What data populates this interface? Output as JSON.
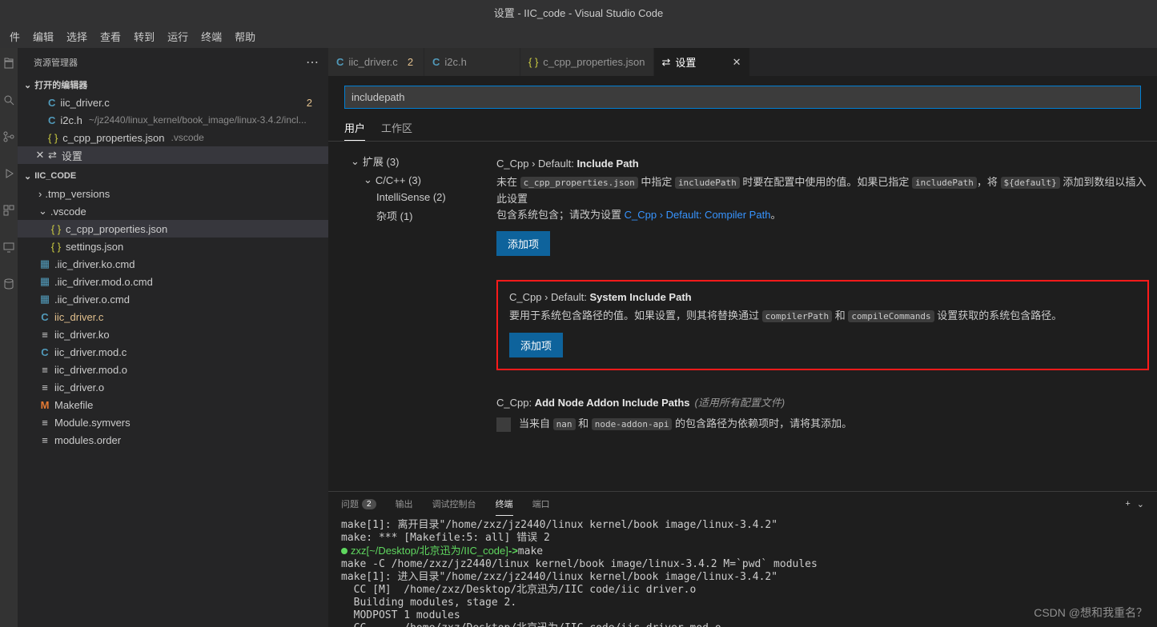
{
  "window_title": "设置 - IIC_code - Visual Studio Code",
  "menu": [
    "件",
    "编辑",
    "选择",
    "查看",
    "转到",
    "运行",
    "终端",
    "帮助"
  ],
  "sidebar": {
    "title": "资源管理器",
    "open_editors": {
      "label": "打开的编辑器",
      "items": [
        {
          "name": "iic_driver.c",
          "modified": true,
          "badge": "2",
          "icon": "c"
        },
        {
          "name": "i2c.h",
          "path": "~/jz2440/linux_kernel/book_image/linux-3.4.2/incl...",
          "icon": "c"
        },
        {
          "name": "c_cpp_properties.json",
          "path": ".vscode",
          "icon": "json"
        },
        {
          "name": "设置",
          "icon": "gear",
          "active": true
        }
      ]
    },
    "folder": {
      "label": "IIC_CODE",
      "tree": [
        {
          "label": ".tmp_versions",
          "type": "folder",
          "depth": 1,
          "expanded": false
        },
        {
          "label": ".vscode",
          "type": "folder",
          "depth": 1,
          "expanded": true
        },
        {
          "label": "c_cpp_properties.json",
          "type": "json",
          "depth": 2,
          "selected": true
        },
        {
          "label": "settings.json",
          "type": "json",
          "depth": 2
        },
        {
          "label": ".iic_driver.ko.cmd",
          "type": "bin",
          "depth": 1
        },
        {
          "label": ".iic_driver.mod.o.cmd",
          "type": "bin",
          "depth": 1
        },
        {
          "label": ".iic_driver.o.cmd",
          "type": "bin",
          "depth": 1
        },
        {
          "label": "iic_driver.c",
          "type": "c",
          "depth": 1,
          "modified": true
        },
        {
          "label": "iic_driver.ko",
          "type": "txt",
          "depth": 1
        },
        {
          "label": "iic_driver.mod.c",
          "type": "c",
          "depth": 1
        },
        {
          "label": "iic_driver.mod.o",
          "type": "txt",
          "depth": 1
        },
        {
          "label": "iic_driver.o",
          "type": "txt",
          "depth": 1
        },
        {
          "label": "Makefile",
          "type": "m",
          "depth": 1
        },
        {
          "label": "Module.symvers",
          "type": "txt",
          "depth": 1
        },
        {
          "label": "modules.order",
          "type": "txt",
          "depth": 1
        }
      ]
    }
  },
  "tabs": [
    {
      "label": "iic_driver.c",
      "icon": "c",
      "modified": true,
      "badge": "2"
    },
    {
      "label": "i2c.h",
      "icon": "c"
    },
    {
      "label": "c_cpp_properties.json",
      "icon": "json"
    },
    {
      "label": "设置",
      "icon": "gear",
      "active": true
    }
  ],
  "settings": {
    "search_value": "includepath",
    "scope_tabs": {
      "user": "用户",
      "workspace": "工作区"
    },
    "tree": {
      "extensions": "扩展 (3)",
      "cpp": "C/C++ (3)",
      "intellisense": "IntelliSense (2)",
      "misc": "杂项 (1)"
    },
    "items": [
      {
        "category": "C_Cpp › Default: ",
        "name": "Include Path",
        "desc_parts": {
          "pre": "未在 ",
          "code1": "c_cpp_properties.json",
          "mid1": " 中指定 ",
          "code2": "includePath",
          "mid2": " 时要在配置中使用的值。如果已指定 ",
          "code3": "includePath",
          "mid3": "，将 ",
          "code4": "${default}",
          "mid4": " 添加到数组以插入此设置",
          "line2_pre": "包含系统包含；请改为设置 ",
          "link": "C_Cpp › Default: Compiler Path",
          "line2_post": "。"
        },
        "button": "添加项"
      },
      {
        "category": "C_Cpp › Default: ",
        "name": "System Include Path",
        "desc_parts": {
          "pre": "要用于系统包含路径的值。如果设置，则其将替换通过 ",
          "code1": "compilerPath",
          "mid": " 和 ",
          "code2": "compileCommands",
          "post": " 设置获取的系统包含路径。"
        },
        "button": "添加项",
        "highlighted": true
      },
      {
        "category": "C_Cpp: ",
        "name": "Add Node Addon Include Paths",
        "scope_hint": "(适用所有配置文件)",
        "checkbox_parts": {
          "pre": "当来自 ",
          "code1": "nan",
          "mid": " 和 ",
          "code2": "node-addon-api",
          "post": " 的包含路径为依赖项时，请将其添加。"
        }
      }
    ]
  },
  "panel": {
    "tabs": {
      "problems": "问题",
      "problems_count": "2",
      "output": "输出",
      "debug": "调试控制台",
      "terminal": "终端",
      "ports": "端口"
    },
    "terminal_lines": [
      "make[1]: 离开目录\"/home/zxz/jz2440/linux kernel/book image/linux-3.4.2\"",
      "make: *** [Makefile:5: all] 错误 2",
      "",
      "make -C /home/zxz/jz2440/linux kernel/book image/linux-3.4.2 M=`pwd` modules",
      "make[1]: 进入目录\"/home/zxz/jz2440/linux kernel/book image/linux-3.4.2\"",
      "  CC [M]  /home/zxz/Desktop/北京迅为/IIC code/iic driver.o",
      "  Building modules, stage 2.",
      "  MODPOST 1 modules",
      "  CC      /home/zxz/Desktop/北京迅为/IIC code/iic driver.mod.o"
    ],
    "prompt": {
      "user": "zxz[~/Desktop/北京迅为/IIC_code]",
      "arrow": "->",
      "cmd": "make"
    }
  },
  "watermark": "CSDN @想和我重名？"
}
